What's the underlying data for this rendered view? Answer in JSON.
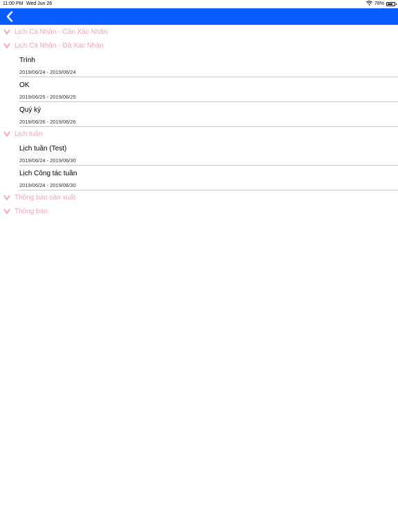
{
  "status_bar": {
    "time": "11:00 PM",
    "date": "Wed Jun 26",
    "battery": "78%",
    "battery_level": 0.78
  },
  "colors": {
    "nav": "#0a5cff",
    "section": "#f5a3c0"
  },
  "sections": [
    {
      "title": "Lịch Cá Nhân - Cần Xác Nhận",
      "items": []
    },
    {
      "title": "Lịch Cá Nhân - Đã Xác Nhận",
      "items": [
        {
          "title": "Trình",
          "dates": "2019/06/24 - 2019/06/24"
        },
        {
          "title": "OK",
          "dates": "2019/06/25 - 2019/06/25"
        },
        {
          "title": "Quý ký",
          "dates": "2019/06/26 - 2019/06/26"
        }
      ]
    },
    {
      "title": "Lịch tuần",
      "items": [
        {
          "title": "Lịch tuần (Test)",
          "dates": "2019/06/24 - 2019/06/30"
        },
        {
          "title": "Lịch Công tác tuần",
          "dates": "2019/06/24 - 2019/06/30"
        }
      ]
    },
    {
      "title": "Thông báo sản xuất",
      "items": []
    },
    {
      "title": "Thông báo",
      "items": []
    }
  ]
}
